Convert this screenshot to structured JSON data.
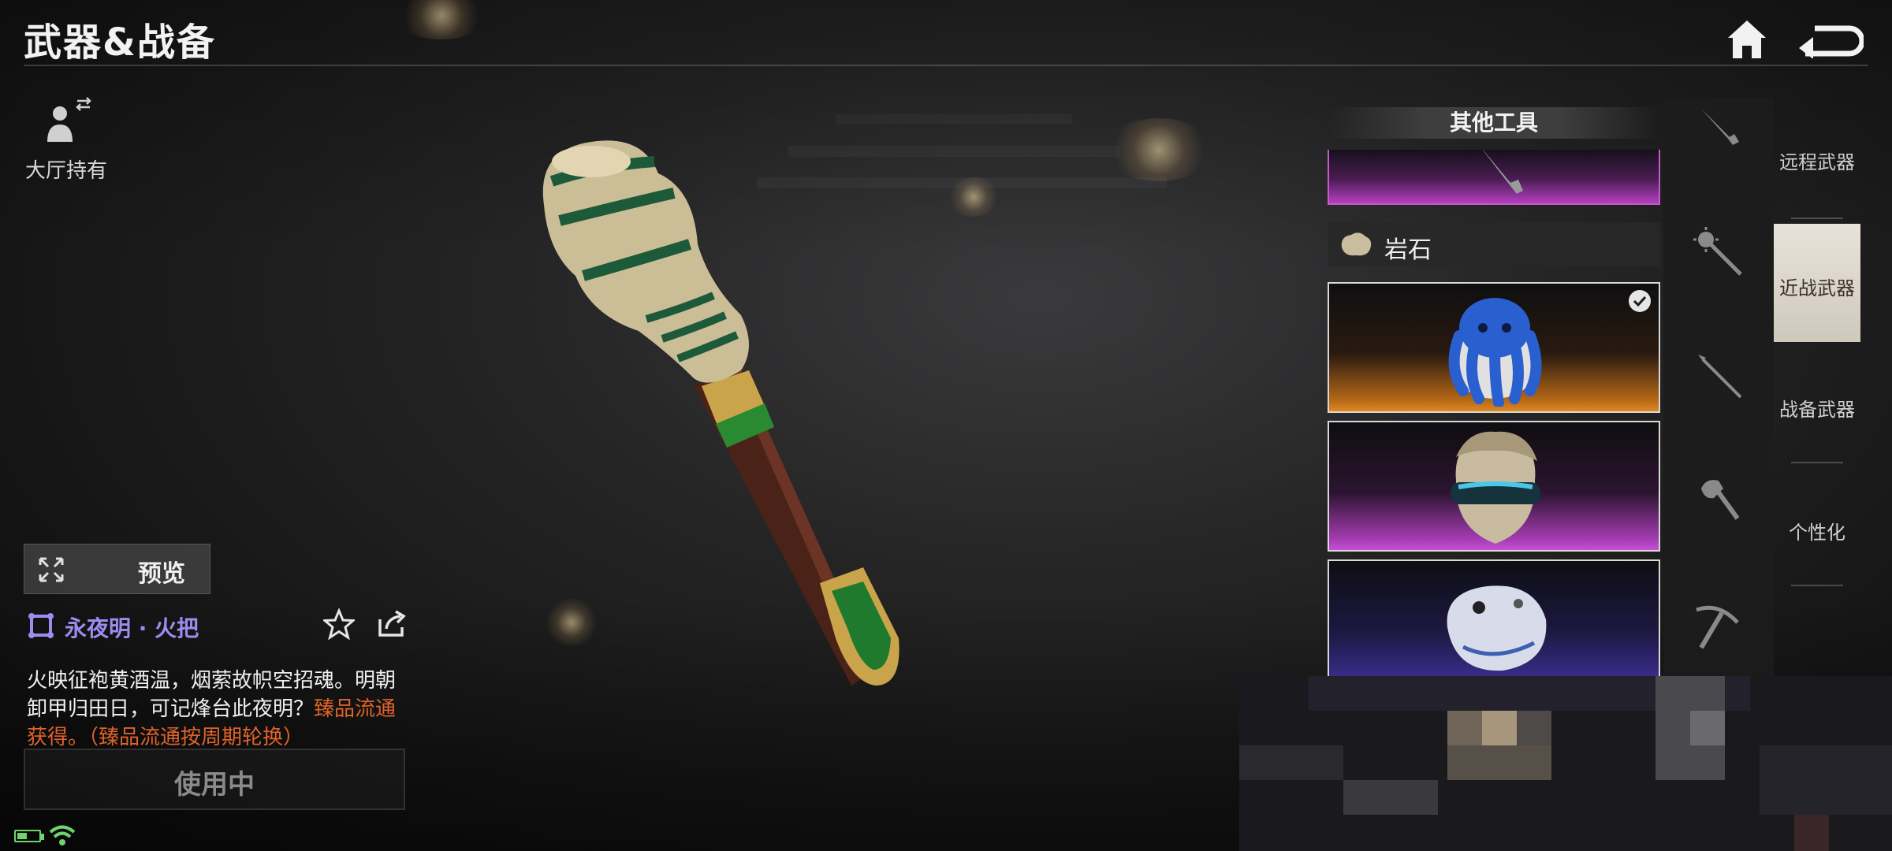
{
  "header": {
    "title": "武器&战备"
  },
  "left_panel": {
    "hall_hold_label": "大厅持有",
    "preview_label": "预览",
    "item_name": "永夜明 · 火把",
    "description_main": "火映征袍黄酒温，烟萦故帜空招魂。明朝卸甲归田日，可记烽台此夜明？",
    "description_highlight": "臻品流通获得。（臻品流通按周期轮换）",
    "use_button_label": "使用中"
  },
  "item_list": {
    "title": "其他工具",
    "subcategory_label": "岩石"
  },
  "tabs": [
    {
      "label": "远程武器",
      "active": false
    },
    {
      "label": "近战武器",
      "active": true
    },
    {
      "label": "战备武器",
      "active": false
    },
    {
      "label": "个性化",
      "active": false
    }
  ],
  "colors": {
    "item_name": "#9d8cf0",
    "highlight_text": "#e0622a",
    "rarity_orange": "#e08a22",
    "rarity_purple": "#c84fd6",
    "rarity_blue": "#3a2c8a"
  },
  "icons": [
    "home-icon",
    "back-icon",
    "person-swap-icon",
    "expand-icon",
    "rarity-badge-icon",
    "star-icon",
    "share-icon",
    "check-icon",
    "battery-icon",
    "wifi-icon",
    "knife-icon",
    "mace-icon",
    "spear-icon",
    "axe-icon",
    "pickaxe-icon"
  ]
}
